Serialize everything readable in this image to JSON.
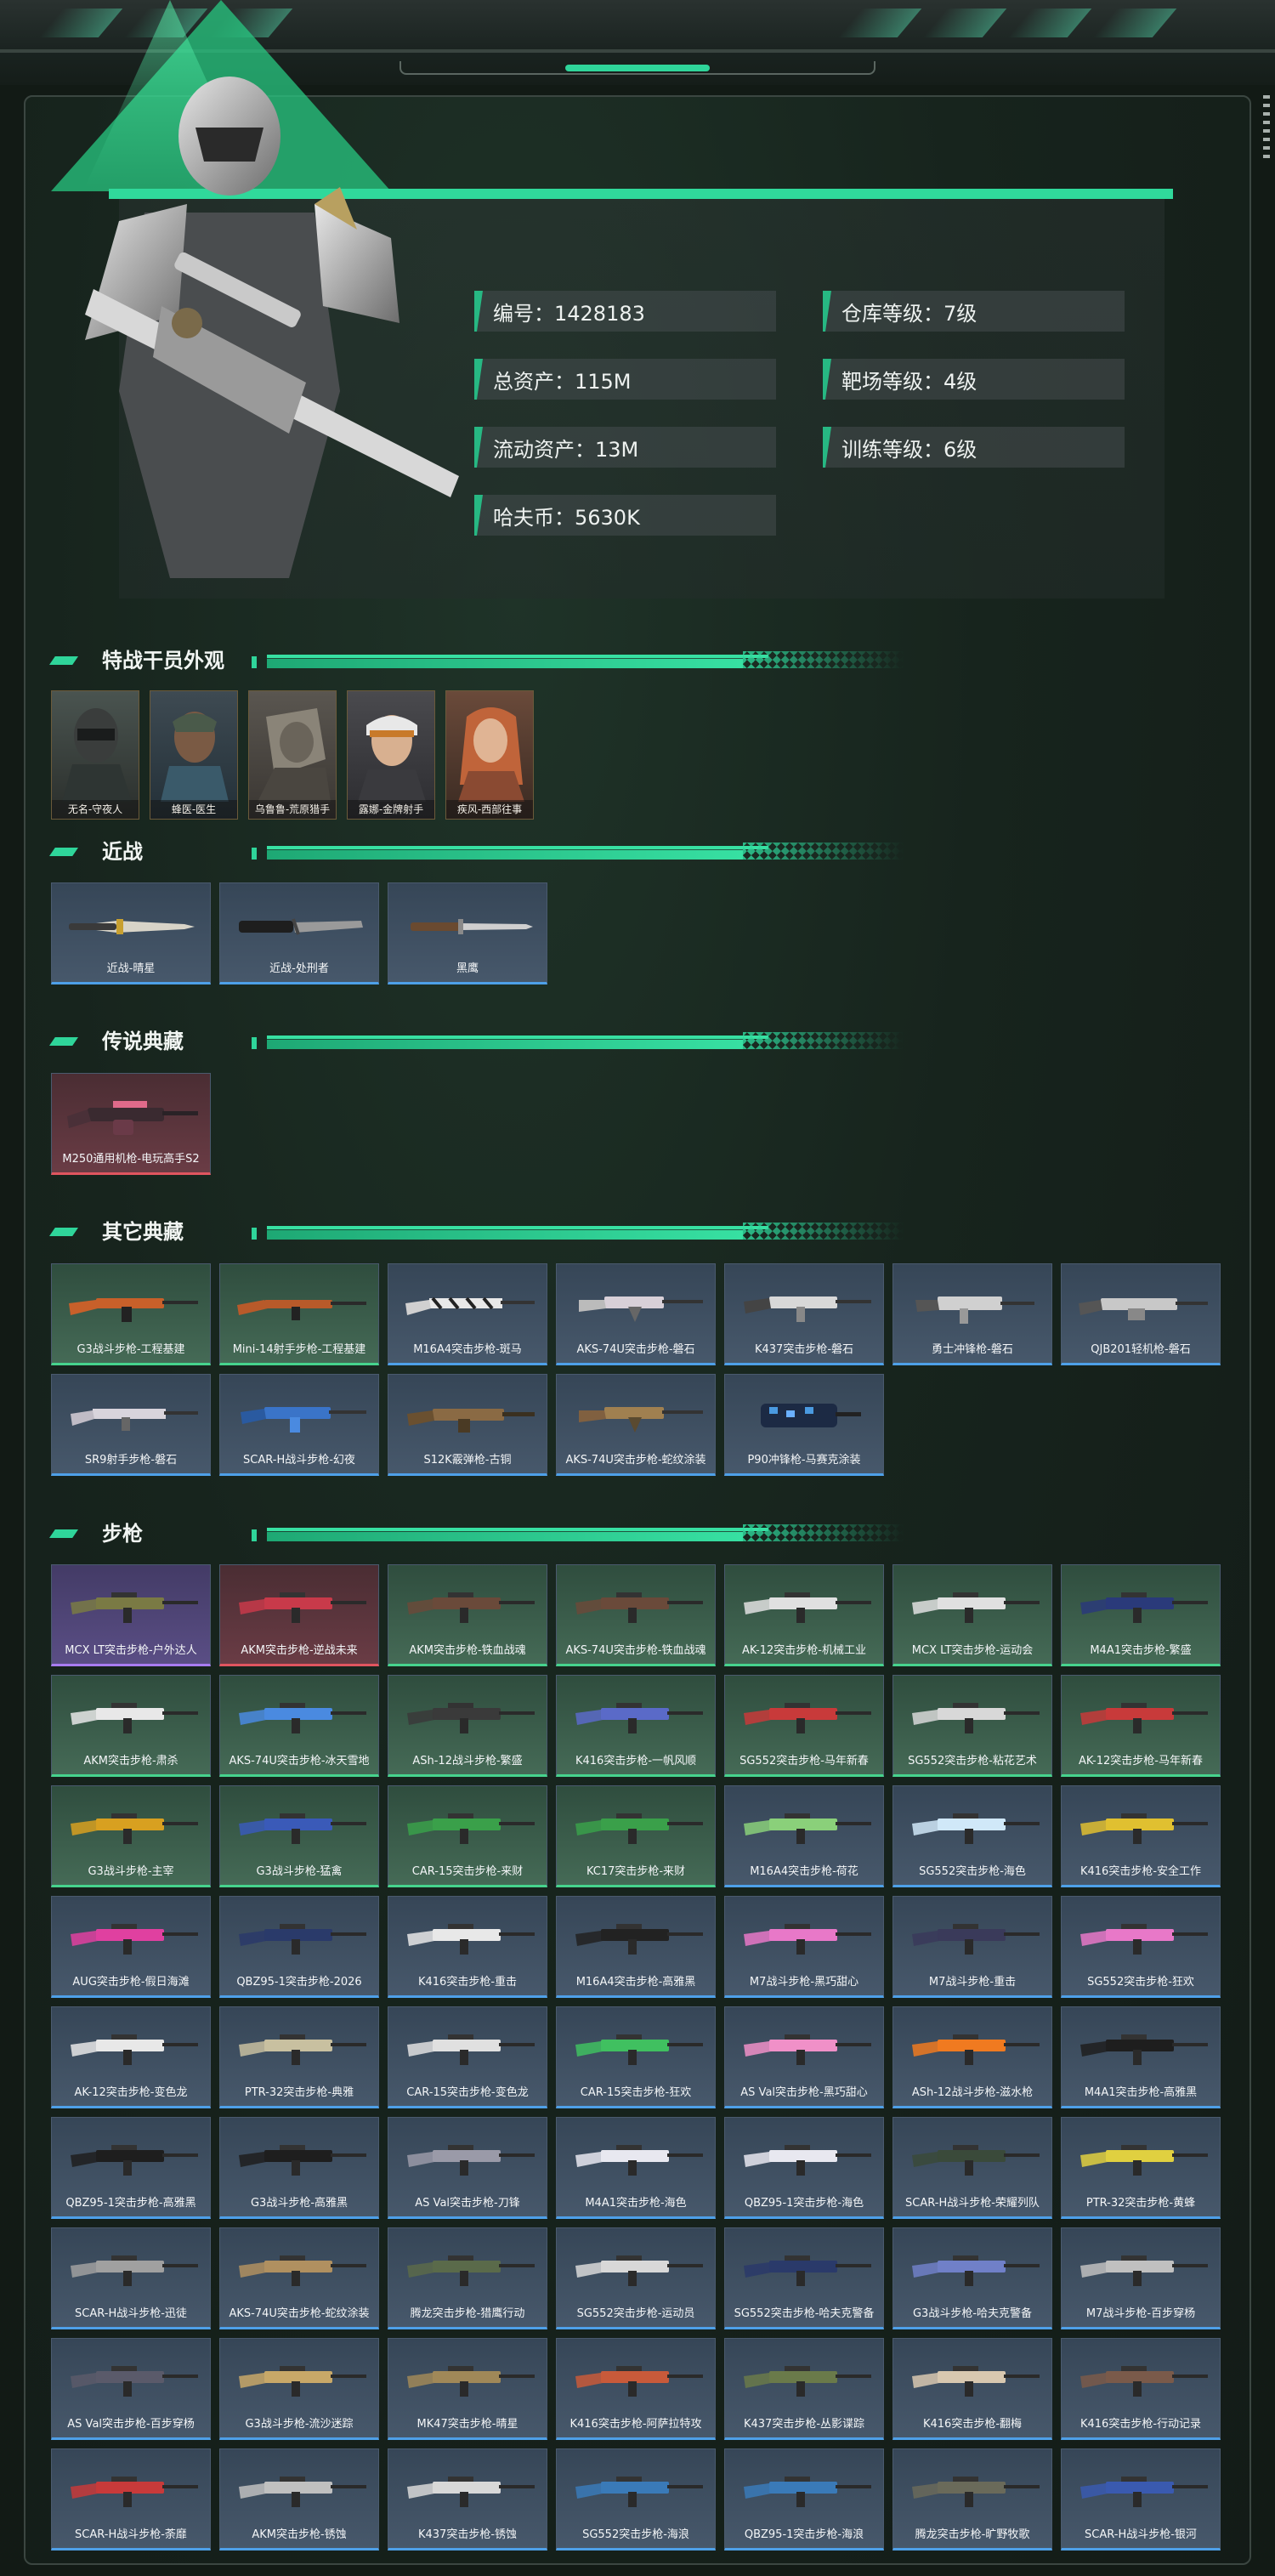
{
  "colors": {
    "accent": "#2fd59a",
    "panel_bg": "#17241d",
    "blue_rarity": "#4ea0e8",
    "green_rarity": "#46d38d",
    "purple_rarity": "#a87cf0",
    "red_rarity": "#e0555f"
  },
  "profile": {
    "stats_left": [
      "编号：1428183",
      "总资产：115M",
      "流动资产：13M",
      "哈夫币：5630K"
    ],
    "stats_right": [
      "仓库等级：7级",
      "靶场等级：4级",
      "训练等级：6级"
    ]
  },
  "sections": {
    "operators": {
      "title": "特战干员外观",
      "items": [
        "无名-守夜人",
        "蜂医-医生",
        "乌鲁鲁-荒原猎手",
        "露娜-金牌射手",
        "疾风-西部往事"
      ]
    },
    "melee": {
      "title": "近战",
      "items": [
        "近战-晴星",
        "近战-处刑者",
        "黑鹰"
      ]
    },
    "legendary": {
      "title": "传说典藏",
      "items": [
        "M250通用机枪-电玩高手S2"
      ]
    },
    "other": {
      "title": "其它典藏",
      "items": [
        "G3战斗步枪-工程基建",
        "Mini-14射手步枪-工程基建",
        "M16A4突击步枪-斑马",
        "AKS-74U突击步枪-磐石",
        "K437突击步枪-磐石",
        "勇士冲锋枪-磐石",
        "QJB201轻机枪-磐石",
        "SR9射手步枪-磐石",
        "SCAR-H战斗步枪-幻夜",
        "S12K霰弹枪-古铜",
        "AKS-74U突击步枪-蛇纹涂装",
        "P90冲锋枪-马赛克涂装"
      ]
    },
    "rifles": {
      "title": "步枪",
      "items": [
        "MCX LT突击步枪-户外达人",
        "AKM突击步枪-逆战未来",
        "AKM突击步枪-铁血战魂",
        "AKS-74U突击步枪-铁血战魂",
        "AK-12突击步枪-机械工业",
        "MCX LT突击步枪-运动会",
        "M4A1突击步枪-繁盛",
        "AKM突击步枪-肃杀",
        "AKS-74U突击步枪-冰天雪地",
        "ASh-12战斗步枪-繁盛",
        "K416突击步枪-一帆风顺",
        "SG552突击步枪-马年新春",
        "SG552突击步枪-粘花艺术",
        "AK-12突击步枪-马年新春",
        "G3战斗步枪-主宰",
        "G3战斗步枪-猛禽",
        "CAR-15突击步枪-来财",
        "KC17突击步枪-来财",
        "M16A4突击步枪-荷花",
        "SG552突击步枪-海色",
        "K416突击步枪-安全工作",
        "AUG突击步枪-假日海滩",
        "QBZ95-1突击步枪-2026",
        "K416突击步枪-重击",
        "M16A4突击步枪-高雅黑",
        "M7战斗步枪-黑巧甜心",
        "M7战斗步枪-重击",
        "SG552突击步枪-狂欢",
        "AK-12突击步枪-变色龙",
        "PTR-32突击步枪-典雅",
        "CAR-15突击步枪-变色龙",
        "CAR-15突击步枪-狂欢",
        "AS Val突击步枪-黑巧甜心",
        "ASh-12战斗步枪-滋水枪",
        "M4A1突击步枪-高雅黑",
        "QBZ95-1突击步枪-高雅黑",
        "G3战斗步枪-高雅黑",
        "AS Val突击步枪-刀锋",
        "M4A1突击步枪-海色",
        "QBZ95-1突击步枪-海色",
        "SCAR-H战斗步枪-荣耀列队",
        "PTR-32突击步枪-黄蜂",
        "SCAR-H战斗步枪-迅徒",
        "AKS-74U突击步枪-蛇纹涂装",
        "腾龙突击步枪-猎鹰行动",
        "SG552突击步枪-运动员",
        "SG552突击步枪-哈夫克警备",
        "G3战斗步枪-哈夫克警备",
        "M7战斗步枪-百步穿杨",
        "AS Val突击步枪-百步穿杨",
        "G3战斗步枪-流沙迷踪",
        "MK47突击步枪-晴星",
        "K416突击步枪-阿萨拉特攻",
        "K437突击步枪-丛影谍踪",
        "K416突击步枪-翻梅",
        "K416突击步枪-行动记录",
        "SCAR-H战斗步枪-荼靡",
        "AKM突击步枪-锈蚀",
        "K437突击步枪-锈蚀",
        "SG552突击步枪-海浪",
        "QBZ95-1突击步枪-海浪",
        "腾龙突击步枪-旷野牧歌",
        "SCAR-H战斗步枪-银河"
      ]
    }
  }
}
